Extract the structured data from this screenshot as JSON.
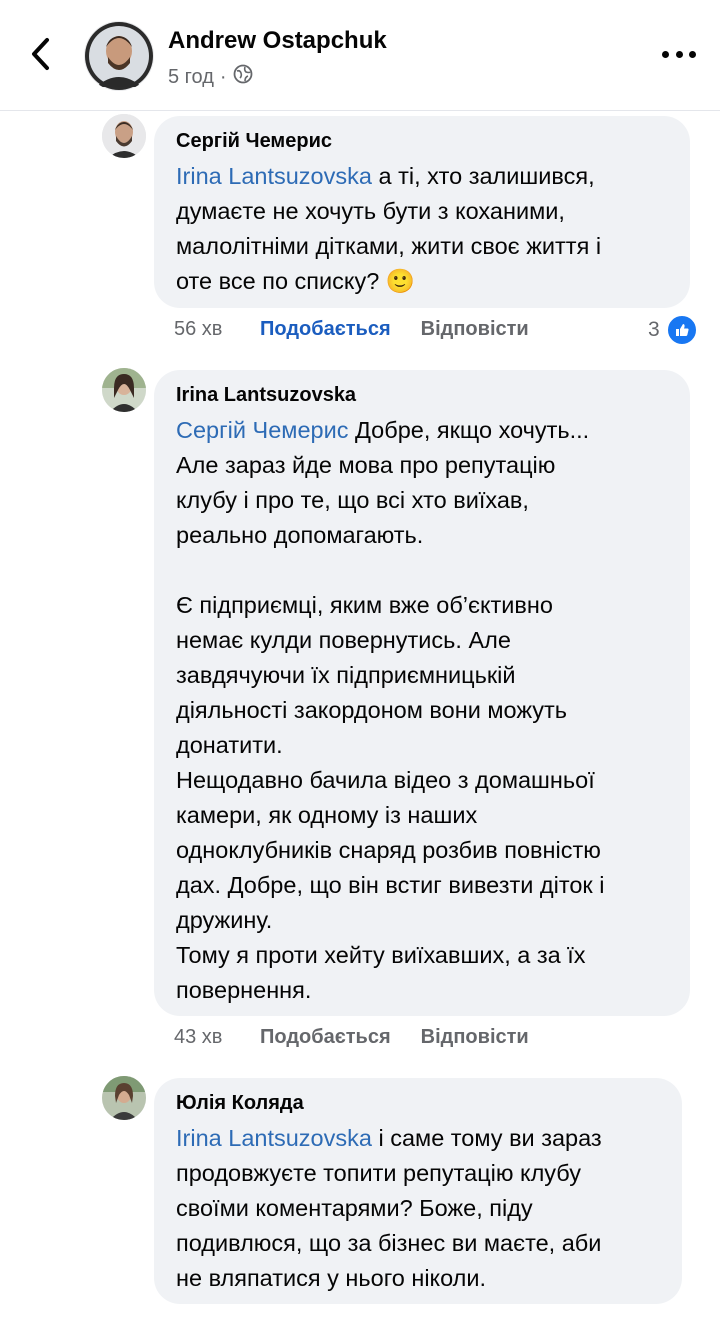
{
  "header": {
    "author": "Andrew Ostapchuk",
    "time": "5 год",
    "separator": "·",
    "back_icon": "chevron-left-icon",
    "privacy_icon": "globe-icon",
    "more_icon": "more-dots-icon"
  },
  "comments": [
    {
      "author": "Сергій Чемерис",
      "mention": "Irina Lantsuzovska",
      "text": " а ті, хто залишився,\nдумаєте не хочуть бути з коханими,\nмалолітніми дітками, жити своє життя і\nоте все по списку? 🙂",
      "time": "56 хв",
      "like": "Подобається",
      "reply": "Відповісти",
      "reaction_count": "3",
      "reaction_icon": "like-reaction-icon"
    },
    {
      "author": "Irina Lantsuzovska",
      "mention": "Сергій Чемерис",
      "text": " Добре, якщо хочуть...\nАле зараз йде мова про репутацію\nклубу і про те, що всі хто виїхав,\nреально допомагають.\n\nЄ підприємці, яким вже об’єктивно\nнемає кулди повернутись. Але\nзавдячуючи їх підприємницькій\nдіяльності закордоном вони можуть\nдонатити.\nНещодавно бачила відео з домашньої\nкамери, як одному із наших\nодноклубників снаряд розбив повністю\nдах. Добре, що він встиг вивезти діток і\nдружину.\nТому я проти хейту виїхавших, а за їх\nповернення.",
      "time": "43 хв",
      "like": "Подобається",
      "reply": "Відповісти"
    },
    {
      "author": "Юлія Коляда",
      "mention": "Irina Lantsuzovska",
      "text": " і саме тому ви зараз\nпродовжуєте топити репутацію клубу\nсвоїми коментарями? Боже, піду\nподивлюся, що за бізнес ви маєте, аби\nне вляпатися у нього ніколи."
    }
  ],
  "colors": {
    "mention": "#2d6bb5",
    "like_active": "#1b5dbf",
    "bubble": "#f0f2f5",
    "meta": "#65676b"
  }
}
